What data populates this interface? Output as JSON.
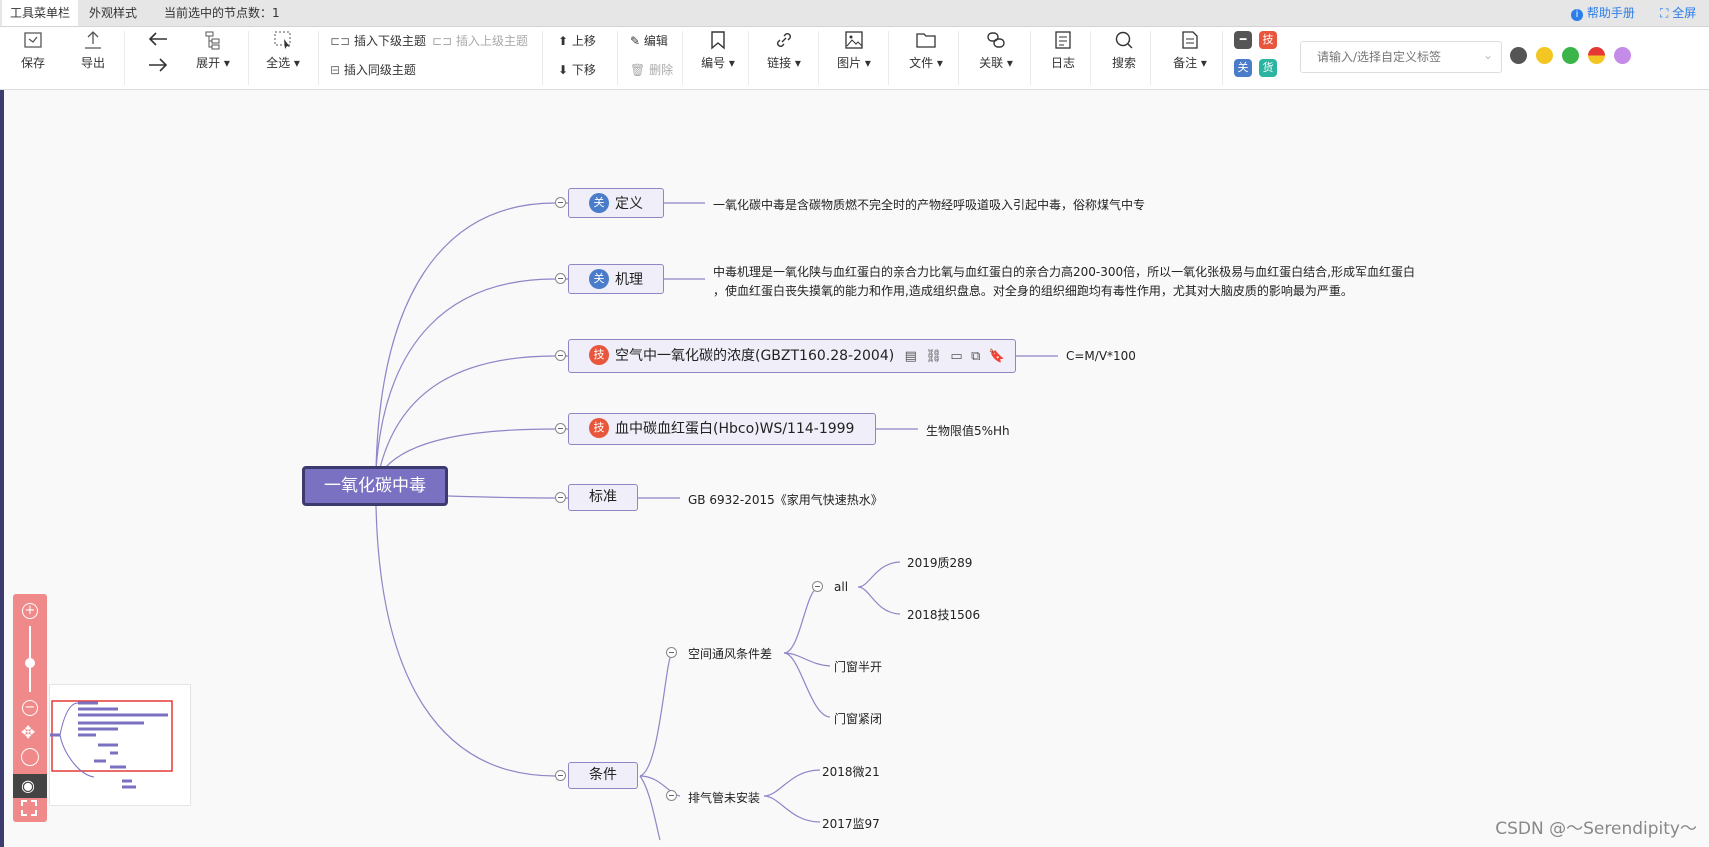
{
  "tabs": {
    "menu": "工具菜单栏",
    "style": "外观样式",
    "selected_count": "当前选中的节点数：1"
  },
  "help": {
    "manual": "帮助手册",
    "fullscreen": "全屏"
  },
  "toolbar": {
    "save": "保存",
    "export": "导出",
    "expand": "展开",
    "select_all": "全选",
    "insert_child": "插入下级主题",
    "insert_parent": "插入上级主题",
    "insert_sibling": "插入同级主题",
    "move_up": "上移",
    "move_down": "下移",
    "edit": "编辑",
    "delete": "删除",
    "number": "编号",
    "link": "链接",
    "image": "图片",
    "file": "文件",
    "relate": "关联",
    "log": "日志",
    "search": "搜索",
    "note": "备注",
    "badge_tech": "技",
    "badge_rel": "关",
    "badge_goods": "货",
    "tag_placeholder": "请输入/选择自定义标签"
  },
  "colors": {
    "accent": "#7b71c2",
    "tag_rel": "#4a7cc9",
    "tag_tech": "#e8573c"
  },
  "mindmap": {
    "root": "一氧化碳中毒",
    "topics": [
      {
        "tag": "关",
        "label": "定义",
        "detail": "一氧化碳中毒是含碳物质燃不完全时的产物经呼吸道吸入引起中毒，俗称煤气中专"
      },
      {
        "tag": "关",
        "label": "机理",
        "detail": "中毒机理是一氧化陕与血红蛋白的亲合力比氧与血红蛋白的亲合力高200-300倍，所以一氧化张极易与血红蛋白结合,形成军血红蛋白",
        "detail2": "，使血红蛋白丧失摸氧的能力和作用,造成组织盘息。对全身的组织细跑均有毒性作用，尤其对大脑皮质的影响最为严重。"
      },
      {
        "tag": "技",
        "label": "空气中一氧化碳的浓度(GBZT160.28-2004)",
        "detail": "C=M/V*100"
      },
      {
        "tag": "技",
        "label": "血中碳血红蛋白(Hbco)WS/114-1999",
        "detail": "生物限值5%Hh"
      },
      {
        "tag": "",
        "label": "标准",
        "detail": "GB 6932-2015《家用气快速热水》"
      },
      {
        "tag": "",
        "label": "条件",
        "detail": ""
      }
    ],
    "conditions": {
      "branch1": "空间通风条件差",
      "all": "all",
      "all_children": [
        "2019质289",
        "2018技1506"
      ],
      "window1": "门窗半开",
      "window2": "门窗紧闭",
      "branch2": "排气管未安装",
      "branch2_children": [
        "2018微21",
        "2017监97"
      ]
    }
  },
  "watermark": "CSDN @～Serendipity～"
}
